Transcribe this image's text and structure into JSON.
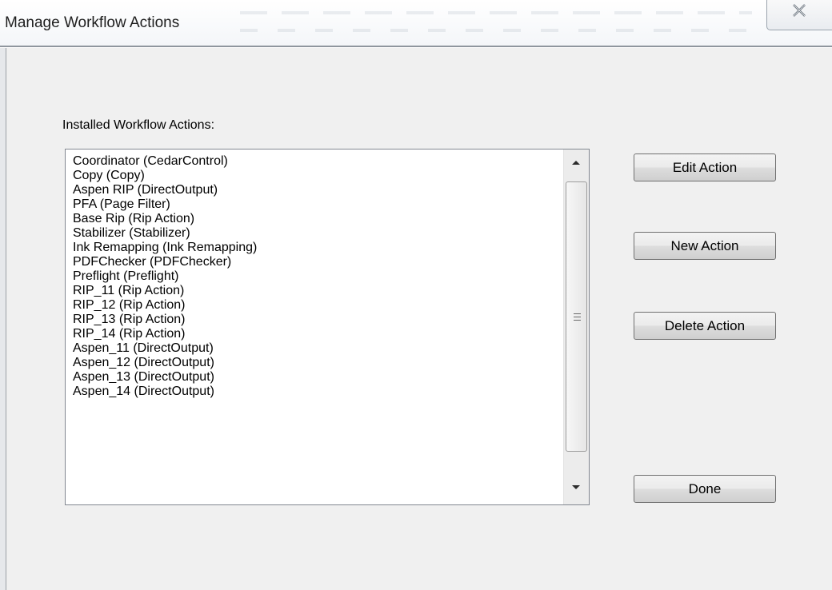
{
  "window": {
    "title": "Manage Workflow Actions",
    "close_icon": "close-x-icon"
  },
  "list": {
    "label": "Installed Workflow Actions:",
    "items": [
      "Coordinator (CedarControl)",
      "Copy (Copy)",
      "Aspen RIP (DirectOutput)",
      "PFA (Page Filter)",
      "Base Rip (Rip Action)",
      "Stabilizer (Stabilizer)",
      "Ink Remapping (Ink Remapping)",
      "PDFChecker (PDFChecker)",
      "Preflight (Preflight)",
      "RIP_11 (Rip Action)",
      "RIP_12 (Rip Action)",
      "RIP_13 (Rip Action)",
      "RIP_14 (Rip Action)",
      "Aspen_11 (DirectOutput)",
      "Aspen_12 (DirectOutput)",
      "Aspen_13 (DirectOutput)",
      "Aspen_14 (DirectOutput)"
    ],
    "scroll_up_icon": "scroll-up-arrow-icon",
    "scroll_down_icon": "scroll-down-arrow-icon"
  },
  "buttons": {
    "edit": "Edit Action",
    "new": "New Action",
    "delete": "Delete Action",
    "done": "Done"
  },
  "colors": {
    "client_background": "#f0f0f0",
    "list_background": "#ffffff",
    "list_border": "#828790",
    "button_border": "#707070"
  }
}
